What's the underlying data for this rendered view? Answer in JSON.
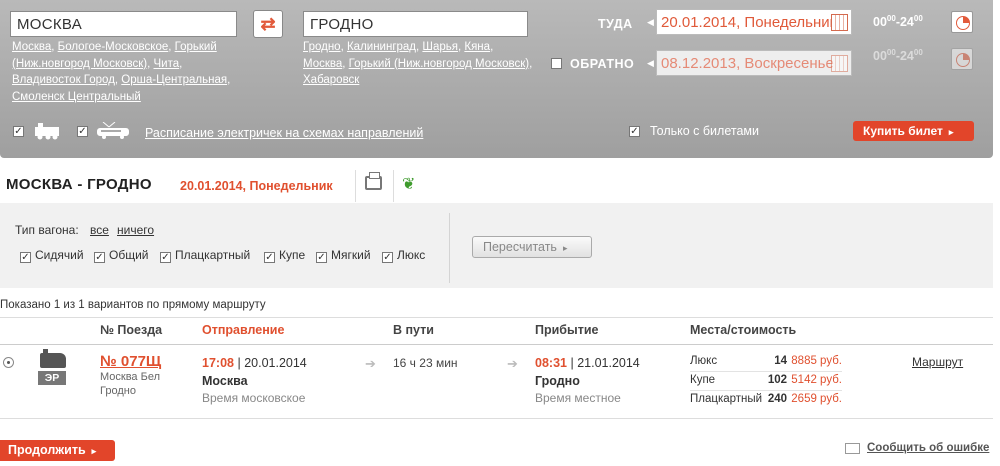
{
  "search": {
    "from_value": "Москва",
    "to_value": "Гродно",
    "from_suggestions": [
      "Москва",
      "Бологое-Московское",
      "Горький (Ниж.новгород Московск)",
      "Чита",
      "Владивосток Город",
      "Орша-Центральная",
      "Смоленск Центральный"
    ],
    "to_suggestions": [
      "Гродно",
      "Калининград",
      "Шарья",
      "Кяна",
      "Москва",
      "Горький (Ниж.новгород Московск)",
      "Хабаровск"
    ],
    "there_label": "ТУДА",
    "back_label": "ОБРАТНО",
    "there_date": "20.01.2014, Понедельник",
    "back_date": "08.12.2013, Воскресенье",
    "time_from": "00",
    "time_from_min": "00",
    "time_to": "24",
    "time_to_min": "00",
    "schedule_link": "Расписание электричек на схемах направлений",
    "only_tickets": "Только с билетами",
    "buy_label": "Купить билет",
    "arrow": "▸"
  },
  "route": {
    "title": "МОСКВА - ГРОДНО",
    "date": "20.01.2014, Понедельник"
  },
  "filter": {
    "label": "Тип вагона:",
    "all": "все",
    "none": "ничего",
    "types": [
      "Сидячий",
      "Общий",
      "Плацкартный",
      "Купе",
      "Мягкий",
      "Люкс"
    ],
    "recalc": "Пересчитать"
  },
  "results": {
    "shown": "Показано 1 из 1 вариантов по прямому маршруту",
    "headers": {
      "train": "№ Поезда",
      "departure": "Отправление",
      "on_way": "В пути",
      "arrival": "Прибытие",
      "seats": "Места/стоимость"
    },
    "rows": [
      {
        "badge": "ЭР",
        "train_no": "№ 077Щ",
        "route_line1": "Москва Бел",
        "route_line2": "Гродно",
        "dep_time": "17:08",
        "dep_date": "20.01.2014",
        "dep_city": "Москва",
        "dep_tz": "Время московское",
        "duration": "16 ч 23 мин",
        "arr_time": "08:31",
        "arr_date": "21.01.2014",
        "arr_city": "Гродно",
        "arr_tz": "Время местное",
        "seats": [
          {
            "class": "Люкс",
            "count": "14",
            "price": "8885 руб."
          },
          {
            "class": "Купе",
            "count": "102",
            "price": "5142 руб."
          },
          {
            "class": "Плацкартный",
            "count": "240",
            "price": "2659 руб."
          }
        ],
        "route_link": "Маршрут"
      }
    ]
  },
  "footer": {
    "continue": "Продолжить",
    "report": "Сообщить об ошибке"
  },
  "colors": {
    "accent": "#e0502f",
    "panel": "#acacac"
  }
}
